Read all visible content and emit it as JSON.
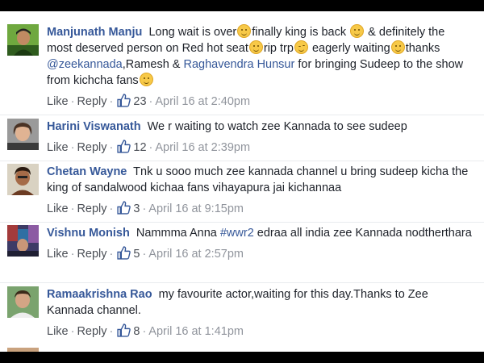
{
  "comments": [
    {
      "author": "Manjunath Manju",
      "segments": [
        "Long wait is over",
        "finally king is back ",
        " & definitely the most deserved person on Red hot seat",
        "rip trp",
        " eagerly waiting",
        "thanks "
      ],
      "mention1": "@zeekannada",
      "mid": ",Ramesh & ",
      "mention2": "Raghavendra Hunsur",
      "tail": " for bringing Sudeep to the show from kichcha fans",
      "like": "Like",
      "reply": "Reply",
      "likes": "23",
      "timestamp": "April 16 at 2:40pm"
    },
    {
      "author": "Harini Viswanath",
      "text": "We r waiting to watch zee Kannada to see sudeep",
      "like": "Like",
      "reply": "Reply",
      "likes": "12",
      "timestamp": "April 16 at 2:39pm"
    },
    {
      "author": "Chetan Wayne",
      "text": "Tnk u sooo much zee kannada channel u bring sudeep kicha the king of sandalwood kichaa fans vihayapura jai kichannaa",
      "like": "Like",
      "reply": "Reply",
      "likes": "3",
      "timestamp": "April 16 at 9:15pm"
    },
    {
      "author": "Vishnu Monish",
      "text_before": "Nammma Anna ",
      "hashtag": "#wwr2",
      "text_after": " edraa all india zee Kannada nodtherthara",
      "like": "Like",
      "reply": "Reply",
      "likes": "5",
      "timestamp": "April 16 at 2:57pm"
    },
    {
      "author": "Ramaakrishna Rao",
      "text": "my favourite actor,waiting for this day.Thanks to Zee Kannada channel.",
      "like": "Like",
      "reply": "Reply",
      "likes": "8",
      "timestamp": "April 16 at 1:41pm"
    }
  ],
  "separator": "·",
  "colors": {
    "link": "#365899",
    "text": "#1d2129",
    "meta": "#90949c"
  }
}
